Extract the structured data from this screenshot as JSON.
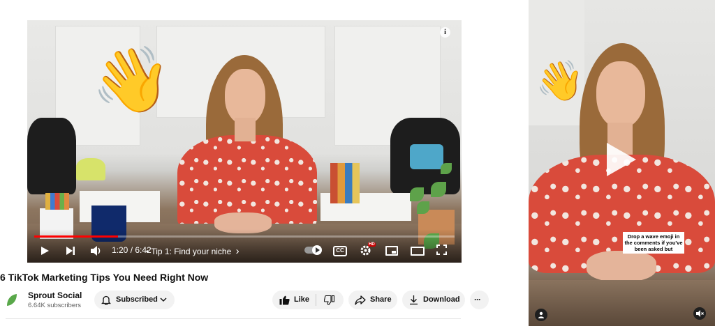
{
  "video": {
    "time_current": "1:20",
    "time_total": "6:42",
    "time_display": "1:20 / 6:42",
    "chapter": "• Tip 1: Find your niche",
    "chapter_arrow": "›",
    "progress_fraction": 0.199,
    "hd_badge": "HD",
    "cc_label": "CC",
    "info_icon": "i",
    "overlay_emoji": "👋",
    "icons": [
      "play-icon",
      "next-icon",
      "volume-icon",
      "autoplay-toggle-icon",
      "captions-icon",
      "settings-icon",
      "miniplayer-icon",
      "theater-mode-icon",
      "fullscreen-icon",
      "info-icon"
    ]
  },
  "title": "6 TikTok Marketing Tips You Need Right Now",
  "channel": {
    "name": "Sprout Social",
    "subscribers": "6.64K subscribers",
    "logo_color": "#59a84a"
  },
  "actions": {
    "subscribed_label": "Subscribed",
    "like_label": "Like",
    "share_label": "Share",
    "download_label": "Download",
    "more_label": "···"
  },
  "short": {
    "caption": "Drop a wave emoji in the comments if you've been asked but",
    "overlay_emoji": "👋",
    "icons": [
      "play-icon",
      "user-icon",
      "mute-icon"
    ]
  },
  "colors": {
    "accent_red": "#ff0000",
    "pill_bg": "#f2f2f2",
    "text_secondary": "#606060"
  }
}
